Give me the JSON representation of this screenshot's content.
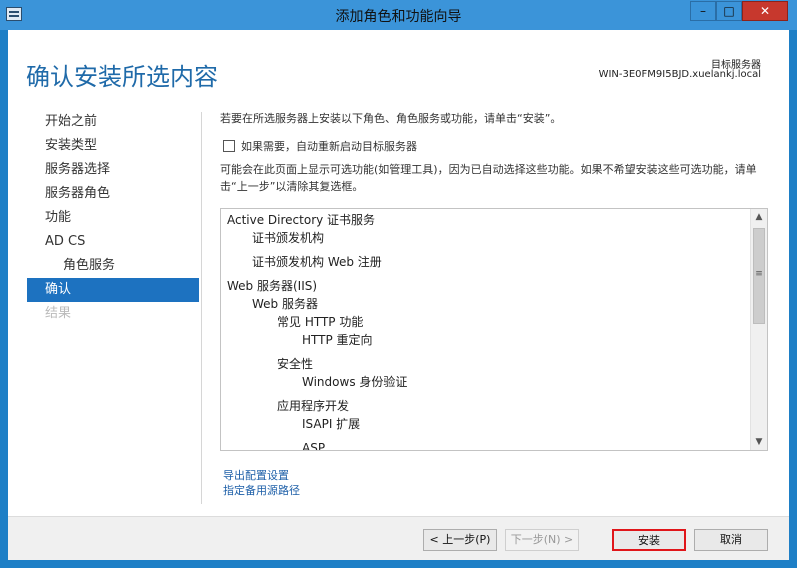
{
  "window": {
    "title": "添加角色和功能向导",
    "minimize": "–",
    "maximize": "□",
    "close": "✕"
  },
  "header": {
    "page_title": "确认安装所选内容",
    "target_label": "目标服务器",
    "target_server": "WIN-3E0FM9I5BJD.xuelankj.local"
  },
  "nav": {
    "items": [
      {
        "label": "开始之前",
        "state": "normal"
      },
      {
        "label": "安装类型",
        "state": "normal"
      },
      {
        "label": "服务器选择",
        "state": "normal"
      },
      {
        "label": "服务器角色",
        "state": "normal"
      },
      {
        "label": "功能",
        "state": "normal"
      },
      {
        "label": "AD CS",
        "state": "normal"
      },
      {
        "label": "角色服务",
        "state": "sub"
      },
      {
        "label": "确认",
        "state": "active"
      },
      {
        "label": "结果",
        "state": "disabled"
      }
    ]
  },
  "content": {
    "intro": "若要在所选服务器上安装以下角色、角色服务或功能，请单击“安装”。",
    "restart_checkbox_label": "如果需要，自动重新启动目标服务器",
    "note": "可能会在此页面上显示可选功能(如管理工具)，因为已自动选择这些功能。如果不希望安装这些可选功能，请单击“上一步”以清除其复选框。",
    "features": [
      {
        "label": "Active Directory 证书服务",
        "level": 0
      },
      {
        "label": "证书颁发机构",
        "level": 1
      },
      {
        "label": "证书颁发机构 Web 注册",
        "level": 1,
        "gap": true
      },
      {
        "label": "Web 服务器(IIS)",
        "level": 0,
        "gap": true
      },
      {
        "label": "Web 服务器",
        "level": 1
      },
      {
        "label": "常见 HTTP 功能",
        "level": 2
      },
      {
        "label": "HTTP 重定向",
        "level": 3
      },
      {
        "label": "安全性",
        "level": 2,
        "gap": true
      },
      {
        "label": "Windows 身份验证",
        "level": 3
      },
      {
        "label": "应用程序开发",
        "level": 2,
        "gap": true
      },
      {
        "label": "ISAPI 扩展",
        "level": 3
      },
      {
        "label": "ASP",
        "level": 3,
        "gap": true
      }
    ],
    "export_link": "导出配置设置",
    "alt_source_link": "指定备用源路径"
  },
  "scrollbar": {
    "up_icon": "▲",
    "down_icon": "▼",
    "grip_icon": "≡"
  },
  "footer": {
    "prev": "< 上一步(P)",
    "next": "下一步(N) >",
    "install": "安装",
    "cancel": "取消"
  }
}
